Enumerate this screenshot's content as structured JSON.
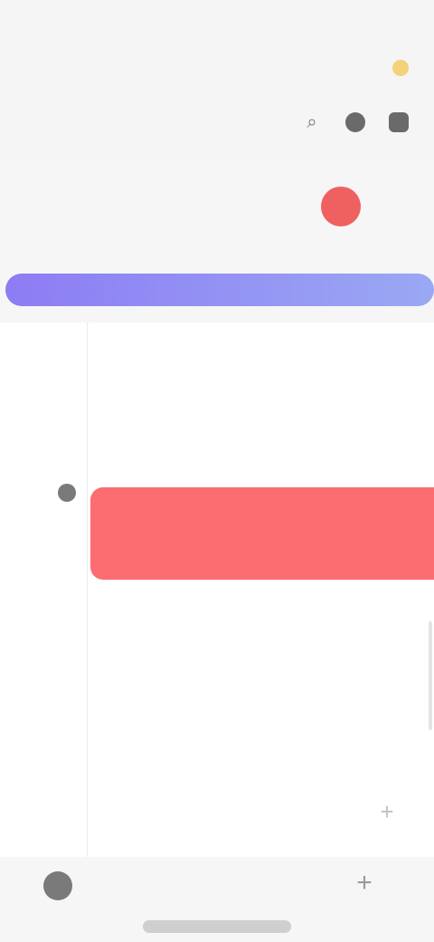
{
  "header": {
    "title_lines": [
      "",
      ""
    ],
    "subtitle": "",
    "top_right": "",
    "info_text": "",
    "weather_icon": "sun-icon",
    "actions": [
      {
        "icon": "search-icon",
        "glyph": "⌕"
      },
      {
        "icon": "circle-icon",
        "glyph": ""
      },
      {
        "icon": "square-icon",
        "glyph": ""
      }
    ]
  },
  "week": {
    "days": [
      {
        "label": "",
        "num": "",
        "selected": false
      },
      {
        "label": "",
        "num": "",
        "selected": false
      },
      {
        "label": "",
        "num": "",
        "selected": false
      },
      {
        "label": "",
        "num": "",
        "selected": false
      },
      {
        "label": "",
        "num": "",
        "selected": false
      },
      {
        "label": "",
        "num": "",
        "selected": true
      },
      {
        "label": "",
        "num": "",
        "selected": false
      }
    ],
    "selected_color": "#ef6161"
  },
  "allday": {
    "label": "",
    "color_start": "#8d7cf4",
    "color_end": "#9aa8f3"
  },
  "timeline": {
    "hours": [
      "",
      "",
      "",
      "",
      "",
      "",
      ""
    ],
    "event": {
      "title": "",
      "color": "#fb6d70"
    },
    "add_icon": "plus-icon"
  },
  "bottom_bar": {
    "avatar_icon": "avatar-icon",
    "text": "",
    "add_icon": "plus-icon"
  }
}
